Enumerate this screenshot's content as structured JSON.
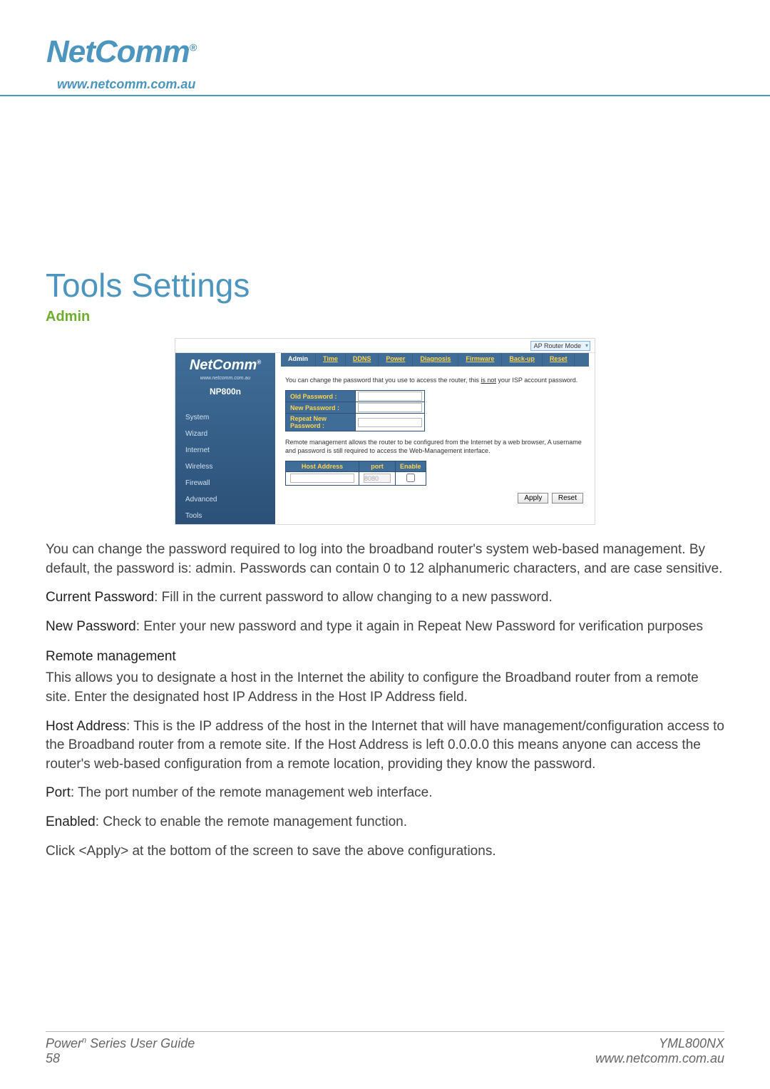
{
  "header": {
    "brand": "NetComm",
    "reg": "®",
    "url": "www.netcomm.com.au"
  },
  "title": "Tools Settings",
  "subsection": "Admin",
  "shot": {
    "mode_label": "AP Router Mode",
    "brand": "NetComm",
    "reg": "®",
    "brand_url": "www.netcomm.com.au",
    "model": "NP800n",
    "sidebar": [
      "System",
      "Wizard",
      "Internet",
      "Wireless",
      "Firewall",
      "Advanced",
      "Tools"
    ],
    "tabs": [
      "Admin",
      "Time",
      "DDNS",
      "Power",
      "Diagnosis",
      "Firmware",
      "Back-up",
      "Reset"
    ],
    "desc1a": "You can change the password that you use to access the router, this ",
    "desc1_isnot": "is not",
    "desc1b": " your ISP account password.",
    "pwd_rows": [
      "Old Password :",
      "New Password :",
      "Repeat New Password :"
    ],
    "desc2": "Remote management allows the router to be configured from the Internet by a web browser, A username and password is still required to access the Web-Management interface.",
    "rm_headers": [
      "Host Address",
      "port",
      "Enable"
    ],
    "port_value": "8080",
    "buttons": {
      "apply": "Apply",
      "reset": "Reset"
    }
  },
  "doc": {
    "p1": "You can change the password required to log into the broadband router's system web-based management. By default, the password is: admin. Passwords can contain 0 to 12 alphanumeric characters, and are case sensitive.",
    "p2_label": "Current Password",
    "p2_text": ": Fill in the current password to allow changing to a new password.",
    "p3_label": "New Password",
    "p3_text": ": Enter your new password and type it again in Repeat New Password for verification purposes",
    "h4": "Remote management",
    "p4": "This allows you to designate a host in the Internet the ability to configure the Broadband router from a remote site. Enter the designated host IP Address in the Host IP Address field.",
    "p5_label": "Host Address",
    "p5_text": ": This is the IP address of the host in the Internet that will have management/configuration access to the Broadband router from a remote site. If the Host Address is left 0.0.0.0 this means anyone can access the router's web-based configuration from a remote location, providing they know the password.",
    "p6_label": "Port",
    "p6_text": ": The port number of the remote management web interface.",
    "p7_label": "Enabled",
    "p7_text": ": Check to enable the remote management function.",
    "p8": "Click <Apply> at the bottom of the screen to save the above configurations."
  },
  "footer": {
    "guide_prefix": "Power",
    "guide_sup": "n",
    "guide_suffix": " Series User Guide",
    "page": "58",
    "model": "YML800NX",
    "url": "www.netcomm.com.au"
  }
}
